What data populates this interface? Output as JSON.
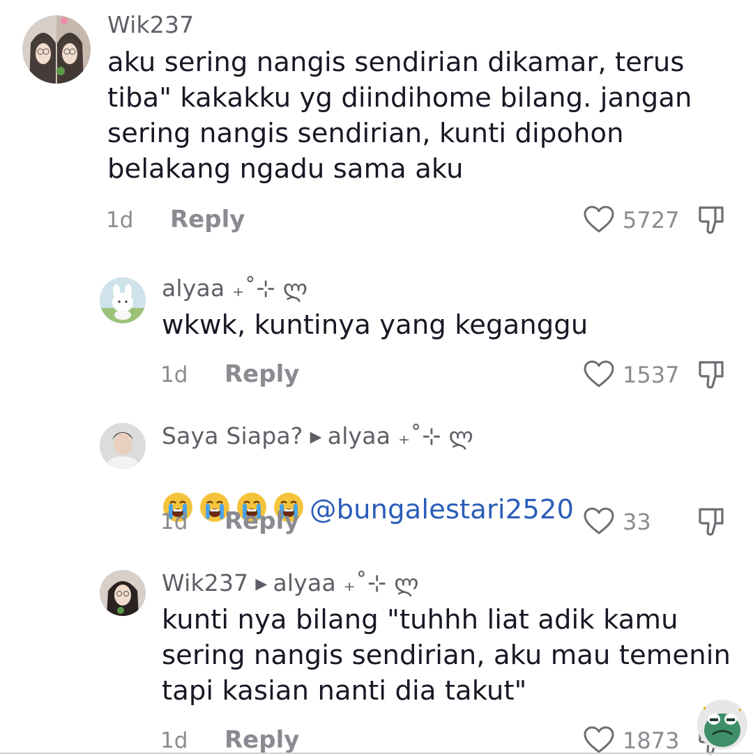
{
  "comments": [
    {
      "username": "Wik237",
      "text": "aku sering nangis sendirian dikamar, terus\ntiba\" kakakku yg diindihome bilang. jangan\nsering nangis sendirian, kunti dipohon\nbelakang ngadu sama aku",
      "time": "1d",
      "reply_label": "Reply",
      "likes": "5727"
    },
    {
      "username": "alyaa ₊˚⊹ ლ",
      "text": "wkwk, kuntinya yang keganggu",
      "time": "1d",
      "reply_label": "Reply",
      "likes": "1537"
    },
    {
      "username": "Saya Siapa?",
      "reply_to": "alyaa ₊˚⊹ ლ",
      "mention": "@bungalestari2520",
      "emoji": "loudly-crying-face",
      "emoji_count": 4,
      "time": "1d",
      "reply_label": "Reply",
      "likes": "33"
    },
    {
      "username": "Wik237",
      "reply_to": "alyaa ₊˚⊹ ლ",
      "text": "kunti nya bilang \"tuhhh liat adik kamu\nsering nangis sendirian, aku mau temenin\ntapi kasian nanti dia takut\"",
      "time": "1d",
      "reply_label": "Reply",
      "likes": "1873"
    }
  ],
  "icons": {
    "like": "heart-outline-icon",
    "dislike": "thumbs-down-icon",
    "reply_arrow": "triangle-right-icon"
  },
  "colors": {
    "mention": "#2b5db9",
    "secondary_text": "#8a8b91",
    "primary_text": "#161823"
  }
}
